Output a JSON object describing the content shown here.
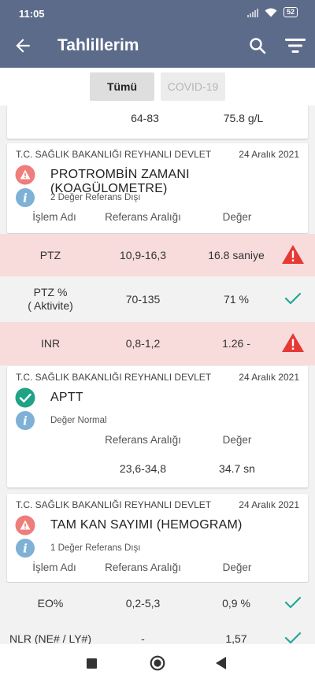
{
  "status_bar": {
    "time": "11:05",
    "battery": "52"
  },
  "app_bar": {
    "title": "Tahlillerim"
  },
  "tabs": [
    {
      "label": "Tümü"
    },
    {
      "label": "COVID-19"
    }
  ],
  "top_partial_row": {
    "reference": "64-83",
    "value": "75.8 g/L"
  },
  "cards": [
    {
      "institution": "T.C. SAĞLIK BAKANLIĞI REYHANLI DEVLET",
      "date": "24 Aralık 2021",
      "name": "PROTROMBİN ZAMANI (KOAGÜLOMETRE)",
      "note": "2 Değer Referans Dışı",
      "headers": {
        "process": "İşlem Adı",
        "reference": "Referans Aralığı",
        "value": "Değer"
      },
      "rows": [
        {
          "name": "PTZ",
          "reference": "10,9-16,3",
          "value": "16.8 saniye",
          "status": "alert"
        },
        {
          "name": "PTZ %\n( Aktivite)",
          "reference": "70-135",
          "value": "71 %",
          "status": "ok"
        },
        {
          "name": "INR",
          "reference": "0,8-1,2",
          "value": "1.26 -",
          "status": "alert"
        }
      ]
    },
    {
      "institution": "T.C. SAĞLIK BAKANLIĞI REYHANLI DEVLET",
      "date": "24 Aralık 2021",
      "name": "APTT",
      "note": "Değer Normal",
      "headers": {
        "reference": "Referans Aralığı",
        "value": "Değer"
      },
      "single": {
        "reference": "23,6-34,8",
        "value": "34.7 sn"
      }
    },
    {
      "institution": "T.C. SAĞLIK BAKANLIĞI REYHANLI DEVLET",
      "date": "24 Aralık 2021",
      "name": "TAM KAN SAYIMI (HEMOGRAM)",
      "note": "1 Değer Referans Dışı",
      "headers": {
        "process": "İşlem Adı",
        "reference": "Referans Aralığı",
        "value": "Değer"
      },
      "rows": [
        {
          "name": "EO%",
          "reference": "0,2-5,3",
          "value": "0,9 %",
          "status": "ok"
        },
        {
          "name": "NLR (NE# / LY#)",
          "reference": "-",
          "value": "1,57",
          "status": "ok"
        }
      ]
    }
  ],
  "colors": {
    "app_bar": "#5d6b8a",
    "alert_row": "#f8dcdc",
    "alert_icon": "#e53935",
    "ok_check": "#26a69a",
    "info_icon": "#7fb0d6"
  },
  "icons": [
    "back-arrow-icon",
    "search-icon",
    "filter-icon",
    "warning-icon",
    "info-icon",
    "check-icon",
    "check-circle-icon"
  ]
}
